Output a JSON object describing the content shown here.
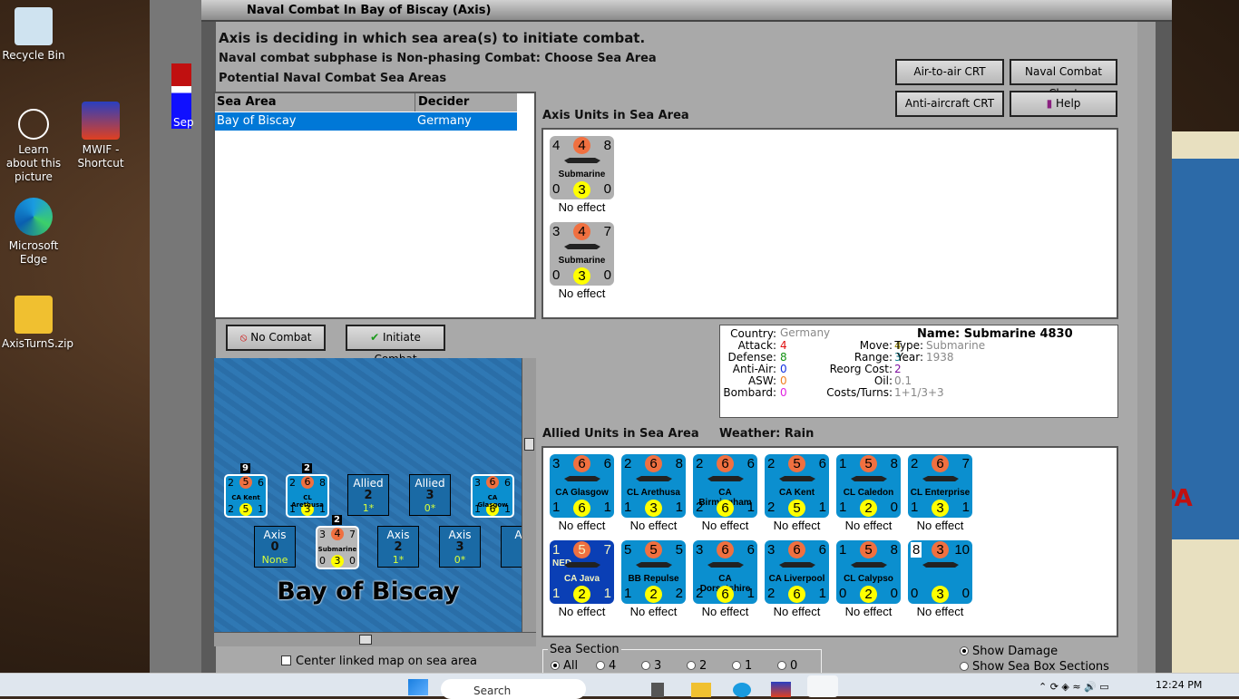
{
  "desktop": {
    "icons": [
      "Recycle Bin",
      "Learn about this picture",
      "MWIF - Shortcut",
      "Microsoft Edge",
      "AxisTurnS.zip"
    ],
    "back_window_label": "Sep"
  },
  "window": {
    "title": "Naval Combat In Bay of Biscay (Axis)"
  },
  "header": {
    "line1": "Axis is deciding in which sea area(s) to initiate combat.",
    "line2": "Naval combat subphase is Non-phasing Combat: Choose Sea Area",
    "line3": "Potential Naval Combat Sea Areas"
  },
  "buttons": {
    "air_to_air": "Air-to-air CRT",
    "naval_chart": "Naval Combat Chart",
    "anti_aircraft": "Anti-aircraft CRT",
    "help": "Help",
    "no_combat": "No Combat",
    "initiate": "Initiate Combat"
  },
  "table": {
    "columns": [
      "Sea Area",
      "Decider"
    ],
    "rows": [
      [
        "Bay of Biscay",
        "Germany"
      ]
    ]
  },
  "axis_units": {
    "title": "Axis Units in Sea Area",
    "units": [
      {
        "tl": "4",
        "tc": "4",
        "tr": "8",
        "name": "Submarine",
        "bl": "0",
        "bc": "3",
        "br": "0",
        "effect": "No effect"
      },
      {
        "tl": "3",
        "tc": "4",
        "tr": "7",
        "name": "Submarine",
        "bl": "0",
        "bc": "3",
        "br": "0",
        "effect": "No effect"
      }
    ]
  },
  "info": {
    "country_label": "Country:",
    "country": "Germany",
    "attack_label": "Attack:",
    "attack": "4",
    "defense_label": "Defense:",
    "defense": "8",
    "aa_label": "Anti-Air:",
    "aa": "0",
    "asw_label": "ASW:",
    "asw": "0",
    "bombard_label": "Bombard:",
    "bombard": "0",
    "move_label": "Move:",
    "move": "4",
    "range_label": "Range:",
    "range": "3",
    "reorg_label": "Reorg Cost:",
    "reorg": "2",
    "oil_label": "Oil:",
    "oil": "0.1",
    "costs_label": "Costs/Turns:",
    "costs": "1+1/3+3",
    "name": "Name: Submarine 4830",
    "type_label": "Type:",
    "type": "Submarine",
    "year_label": "Year:",
    "year": "1938"
  },
  "allied_units": {
    "title": "Allied Units in Sea Area",
    "weather": "Weather:  Rain",
    "units": [
      {
        "tl": "3",
        "tc": "6",
        "tr": "6",
        "name": "CA Glasgow",
        "bl": "1",
        "bc": "6",
        "br": "1",
        "effect": "No effect"
      },
      {
        "tl": "2",
        "tc": "6",
        "tr": "8",
        "name": "CL Arethusa",
        "bl": "1",
        "bc": "3",
        "br": "1",
        "effect": "No effect"
      },
      {
        "tl": "2",
        "tc": "6",
        "tr": "6",
        "name": "CA Birmingham",
        "bl": "2",
        "bc": "6",
        "br": "1",
        "effect": "No effect"
      },
      {
        "tl": "2",
        "tc": "5",
        "tr": "6",
        "name": "CA Kent",
        "bl": "2",
        "bc": "5",
        "br": "1",
        "effect": "No effect"
      },
      {
        "tl": "1",
        "tc": "5",
        "tr": "8",
        "name": "CL Caledon",
        "bl": "1",
        "bc": "2",
        "br": "0",
        "effect": "No effect"
      },
      {
        "tl": "2",
        "tc": "6",
        "tr": "7",
        "name": "CL Enterprise",
        "bl": "1",
        "bc": "3",
        "br": "1",
        "effect": "No effect"
      },
      {
        "tl": "1",
        "tc": "5",
        "tr": "7",
        "name": "CA Java",
        "tag": "NED",
        "bl": "1",
        "bc": "2",
        "br": "1",
        "effect": "No effect",
        "dark": true
      },
      {
        "tl": "5",
        "tc": "5",
        "tr": "5",
        "name": "BB Repulse",
        "bl": "1",
        "bc": "2",
        "br": "2",
        "effect": "No effect"
      },
      {
        "tl": "3",
        "tc": "6",
        "tr": "6",
        "name": "CA Dorsetshire",
        "bl": "2",
        "bc": "6",
        "br": "1",
        "effect": "No effect"
      },
      {
        "tl": "3",
        "tc": "6",
        "tr": "6",
        "name": "CA Liverpool",
        "bl": "2",
        "bc": "6",
        "br": "1",
        "effect": "No effect"
      },
      {
        "tl": "1",
        "tc": "5",
        "tr": "8",
        "name": "CL Calypso",
        "bl": "0",
        "bc": "2",
        "br": "0",
        "effect": "No effect"
      },
      {
        "tl": "8",
        "tc": "3",
        "tr": "10",
        "name": "",
        "bl": "0",
        "bc": "3",
        "br": "0",
        "effect": "No effect"
      }
    ]
  },
  "map": {
    "sea_name": "Bay of Biscay",
    "row1": [
      {
        "kind": "unit",
        "stack": "9",
        "tl": "2",
        "tc": "5",
        "tr": "6",
        "name": "CA Kent",
        "bl": "2",
        "bc": "5",
        "br": "1"
      },
      {
        "kind": "unit",
        "stack": "2",
        "tl": "2",
        "tc": "6",
        "tr": "8",
        "name": "CL Arethusa",
        "bl": "1",
        "bc": "3",
        "br": "1"
      },
      {
        "kind": "box",
        "side": "Allied",
        "num": "2",
        "sub": "1*"
      },
      {
        "kind": "box",
        "side": "Allied",
        "num": "3",
        "sub": "0*"
      },
      {
        "kind": "unit",
        "stack": "",
        "tl": "3",
        "tc": "6",
        "tr": "6",
        "name": "CA Glasgow",
        "bl": "1",
        "bc": "6",
        "br": "1"
      }
    ],
    "row2": [
      {
        "kind": "box",
        "side": "Axis",
        "num": "0",
        "sub": "None"
      },
      {
        "kind": "unit",
        "gray": true,
        "stack": "2",
        "tl": "3",
        "tc": "4",
        "tr": "7",
        "name": "Submarine",
        "bl": "0",
        "bc": "3",
        "br": "0"
      },
      {
        "kind": "box",
        "side": "Axis",
        "num": "2",
        "sub": "1*"
      },
      {
        "kind": "box",
        "side": "Axis",
        "num": "3",
        "sub": "0*"
      },
      {
        "kind": "box",
        "side": "Ax",
        "num": "",
        "sub": ""
      }
    ]
  },
  "options": {
    "center_map": "Center linked map on sea area",
    "sea_section_title": "Sea Section",
    "sections": [
      "All",
      "4",
      "3",
      "2",
      "1",
      "0"
    ],
    "show_damage": "Show Damage",
    "show_sea_box": "Show Sea Box Sections"
  },
  "taskbar": {
    "search": "Search",
    "time": "12:24 PM"
  },
  "right_map_text": "PA"
}
